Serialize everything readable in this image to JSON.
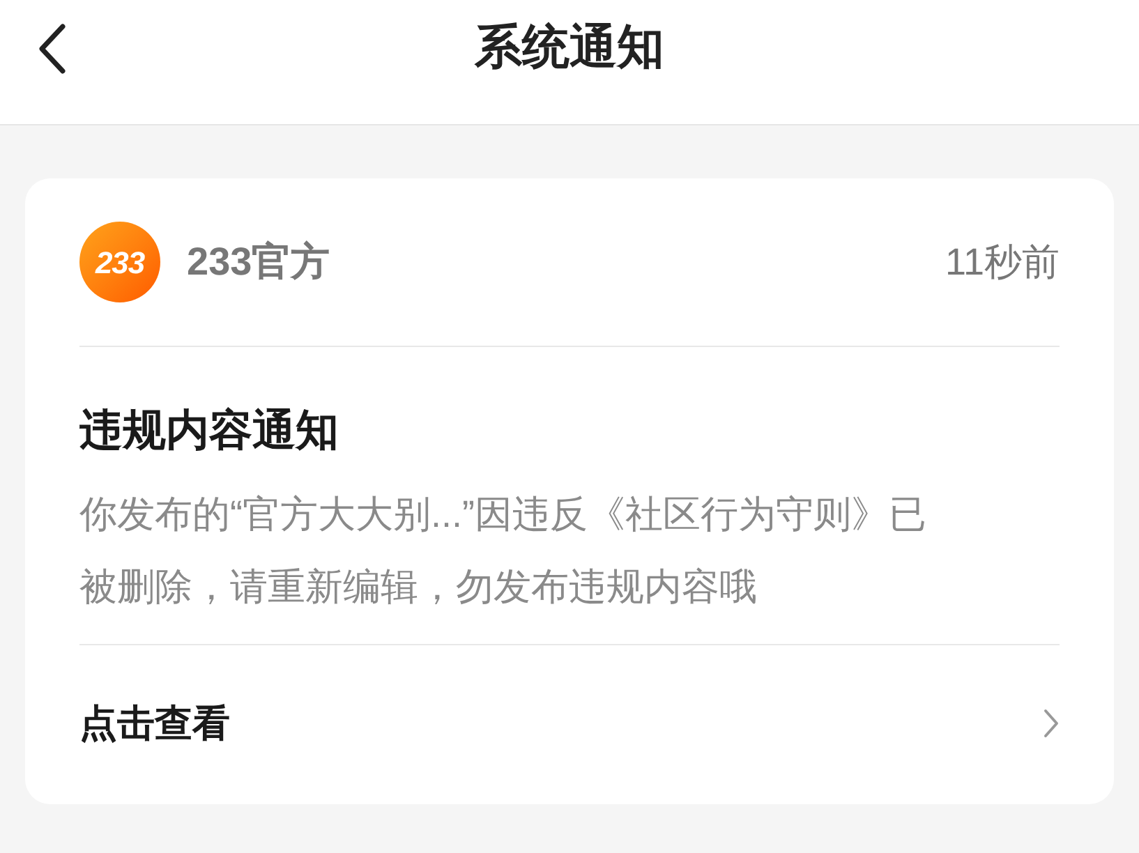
{
  "header": {
    "title": "系统通知"
  },
  "notice": {
    "sender": {
      "logo": "233",
      "name": "233官方"
    },
    "time": "11秒前",
    "title": "违规内容通知",
    "body_lines": [
      "你发布的“官方大大别...”因违反《社区行为守则》已",
      "被删除，请重新编辑，勿发布违规内容哦"
    ],
    "action": "点击查看"
  }
}
